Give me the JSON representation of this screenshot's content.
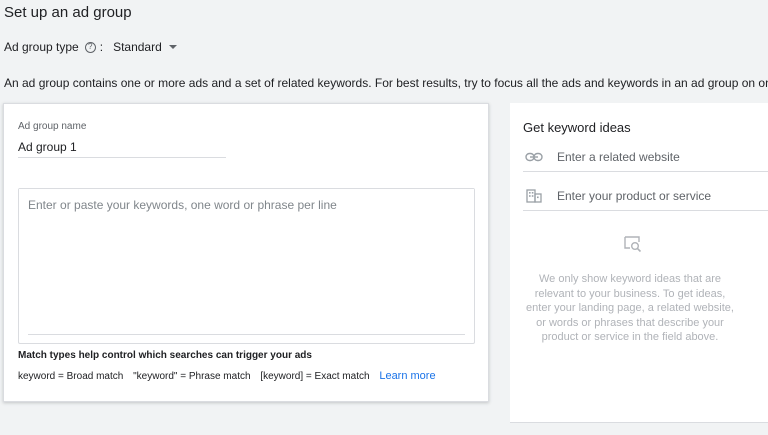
{
  "page": {
    "title": "Set up an ad group",
    "ad_group_type_label": "Ad group type",
    "ad_group_type_separator": ":",
    "ad_group_type_value": "Standard",
    "description": "An ad group contains one or more ads and a set of related keywords. For best results, try to focus all the ads and keywords in an ad group on one product"
  },
  "ad_group": {
    "name_label": "Ad group name",
    "name_value": "Ad group 1",
    "keywords_placeholder": "Enter or paste your keywords, one word or phrase per line",
    "match_types_title": "Match types help control which searches can trigger your ads",
    "match_types": {
      "broad": "keyword = Broad match",
      "phrase": "\"keyword\" = Phrase match",
      "exact": "[keyword] = Exact match"
    },
    "learn_more": "Learn more"
  },
  "keyword_ideas": {
    "title": "Get keyword ideas",
    "website_placeholder": "Enter a related website",
    "product_placeholder": "Enter your product or service",
    "empty_message": "We only show keyword ideas that are relevant to your business. To get ideas, enter your landing page, a related website, or words or phrases that describe your product or service in the field above."
  },
  "icons": {
    "help": "help-circle-icon",
    "dropdown": "dropdown-caret-icon",
    "link": "link-icon",
    "product": "building-icon",
    "empty_state": "search-ideas-icon"
  },
  "colors": {
    "accent": "#1a73e8",
    "background": "#f1f3f4",
    "card": "#ffffff",
    "muted_text": "#b0b3b8"
  }
}
